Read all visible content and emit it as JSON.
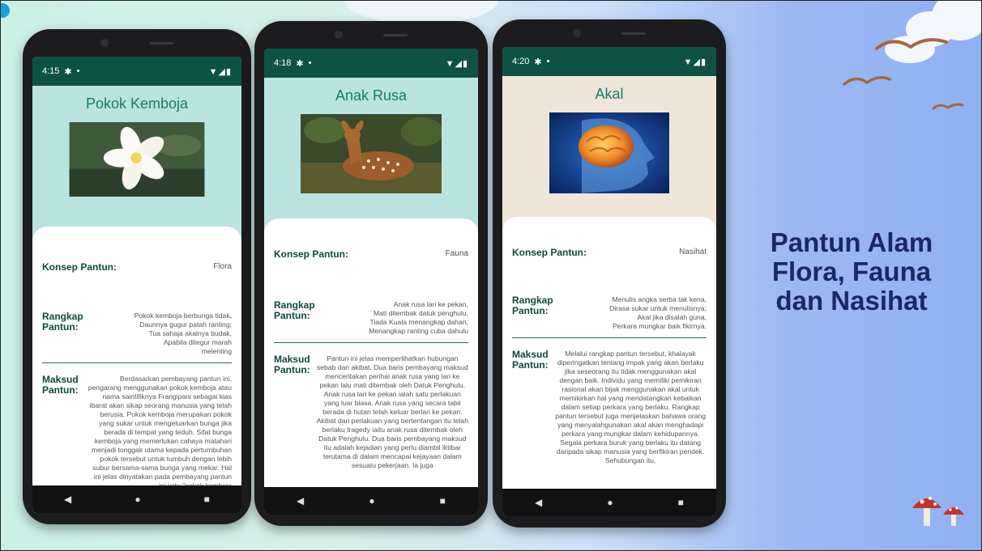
{
  "title": [
    "Pantun Alam",
    "Flora, Fauna",
    "dan Nasihat"
  ],
  "phones": [
    {
      "time": "4:15",
      "heading": "Pokok Kemboja",
      "image": "frangipani-flower",
      "konsep_label": "Konsep Pantun:",
      "konsep_value": "Flora",
      "rangkap_label": "Rangkap Pantun:",
      "rangkap_lines": [
        "Pokok kemboja berbunga tidak,",
        "Daunnya gugur patah ranting;",
        "Tua sahaja akalnya budak,",
        "Apabila ditegur marah",
        "melenting"
      ],
      "maksud_label": "Maksud Pantun:",
      "maksud_text": "Berdasarkan pembayang pantun ini, pengarang menggunakan pokok kemboja atau nama saintifiknya Frangipani sebagai kias ibarat akan sikap seorang manusia yang telah berusia. Pokok kemboja merupakan pokok yang sukar untuk mengeluarkan bunga jika berada di tempat yang teduh. Sifat bunga kemboja yang memerlukan cahaya matahari menjadi tonggak utama kepada pertumbuhan pokok tersebut untuk tumbuh dengan lebih subur bersama-sama bunga yang mekar. Hal ini jelas dinyatakan pada pembayang pantun ini iaitu \"pokok kemboja"
    },
    {
      "time": "4:18",
      "heading": "Anak Rusa",
      "image": "fawn",
      "konsep_label": "Konsep Pantun:",
      "konsep_value": "Fauna",
      "rangkap_label": "Rangkap Pantun:",
      "rangkap_lines": [
        "Anak rusa lari ke pekan,",
        "Mati ditembak datuk penghulu,",
        "Tiada Kuala menangkap dahan,",
        "Menangkap ranting cuba dahulu"
      ],
      "maksud_label": "Maksud Pantun:",
      "maksud_text": "Pantun ini jelas memperlihatkan hubungan sebab dan akibat. Dua baris pembayang maksud menceritakan perihal anak rusa yang lari ke pekan lalu mati ditembak oleh Datuk Penghulu. Anak rusa lari ke pekan ialah satu perlakuan yang luar biasa. Anak rusa yang secara tabii berada di hutan telah keluar berlari ke pekan. Akibat dari perlakuan yang bertentangan itu telah berlaku tragedy iaitu anak rusa ditembak oleh Datuk Penghulu. Dua baris pembayang maksud itu adalah kejadian yang perlu diambil iktibar terutama di dalam mencapai kejayaan dalam sesuatu pekerjaan. Ia juga"
    },
    {
      "time": "4:20",
      "heading": "Akal",
      "image": "brain",
      "konsep_label": "Konsep Pantun:",
      "konsep_value": "Nasihat",
      "rangkap_label": "Rangkap Pantun:",
      "rangkap_lines": [
        "Menulis angka serba tak kena,",
        "Dirasa sukar untuk menulisnya;",
        "Akal jika disalah guna,",
        "Perkara mungkar baik fikirnya."
      ],
      "maksud_label": "Maksud Pantun:",
      "maksud_text": "Melalui rangkap pantun tersebut, khalayak diperingatkan tentang impak yang akan berlaku jika seseorang itu tidak menggunakan akal dengan baik. Individu yang memiliki pemikiran rasional akan bijak menggunakan akal untuk memikirkan hal yang mendatangkan kebaikan dalam setiap perkara yang berlaku. Rangkap pantun tersebut juga menjelaskan bahawa orang yang menyalahgunakan akal akan menghadapi perkara yang mungkar dalam kehidupannya. Segala perkara buruk yang berlaku itu datang daripada sikap manusia yang berfikiran pendek. Sehubungan itu,"
    }
  ],
  "nav": {
    "back": "◀",
    "home": "●",
    "recents": "■"
  },
  "colors": {
    "title": "#1b2866",
    "status_bar": "#0e5244",
    "heading": "#1a7a6d"
  }
}
